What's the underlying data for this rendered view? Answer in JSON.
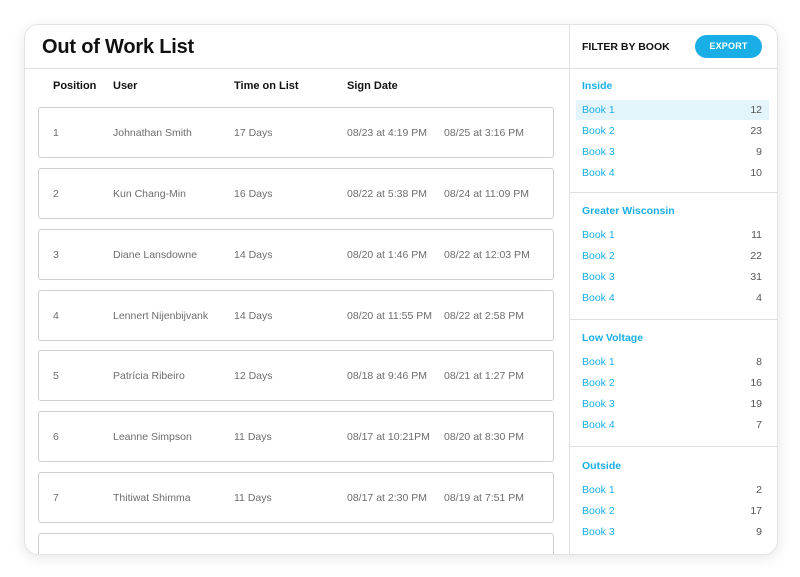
{
  "title": "Out of Work List",
  "columns": {
    "position": "Position",
    "user": "User",
    "time": "Time on List",
    "sign": "Sign Date"
  },
  "rows": [
    {
      "position": "1",
      "user": "Johnathan Smith",
      "time": "17 Days",
      "sign": "08/23 at 4:19 PM",
      "date2": "08/25 at 3:16 PM"
    },
    {
      "position": "2",
      "user": "Kun Chang-Min",
      "time": "16 Days",
      "sign": "08/22 at 5:38 PM",
      "date2": "08/24 at 11:09 PM"
    },
    {
      "position": "3",
      "user": "Diane Lansdowne",
      "time": "14 Days",
      "sign": "08/20 at 1:46 PM",
      "date2": "08/22 at 12:03 PM"
    },
    {
      "position": "4",
      "user": "Lennert Nijenbijvank",
      "time": "14 Days",
      "sign": "08/20 at 11:55 PM",
      "date2": "08/22 at 2:58 PM"
    },
    {
      "position": "5",
      "user": "Patrícia Ribeiro",
      "time": "12 Days",
      "sign": "08/18 at 9:46 PM",
      "date2": "08/21 at 1:27 PM"
    },
    {
      "position": "6",
      "user": "Leanne Simpson",
      "time": "11 Days",
      "sign": "08/17 at 10:21PM",
      "date2": "08/20 at 8:30 PM"
    },
    {
      "position": "7",
      "user": "Thitiwat Shimma",
      "time": "11 Days",
      "sign": "08/17 at 2:30 PM",
      "date2": "08/19 at 7:51 PM"
    }
  ],
  "sidebar": {
    "filter_label": "FILTER BY BOOK",
    "export_label": "EXPORT",
    "selected": "Inside / Book 1",
    "groups": [
      {
        "name": "Inside",
        "books": [
          {
            "name": "Book 1",
            "count": "12"
          },
          {
            "name": "Book 2",
            "count": "23"
          },
          {
            "name": "Book 3",
            "count": "9"
          },
          {
            "name": "Book 4",
            "count": "10"
          }
        ]
      },
      {
        "name": "Greater Wisconsin",
        "books": [
          {
            "name": "Book 1",
            "count": "11"
          },
          {
            "name": "Book 2",
            "count": "22"
          },
          {
            "name": "Book 3",
            "count": "31"
          },
          {
            "name": "Book 4",
            "count": "4"
          }
        ]
      },
      {
        "name": "Low Voltage",
        "books": [
          {
            "name": "Book 1",
            "count": "8"
          },
          {
            "name": "Book 2",
            "count": "16"
          },
          {
            "name": "Book 3",
            "count": "19"
          },
          {
            "name": "Book 4",
            "count": "7"
          }
        ]
      },
      {
        "name": "Outside",
        "books": [
          {
            "name": "Book 1",
            "count": "2"
          },
          {
            "name": "Book 2",
            "count": "17"
          },
          {
            "name": "Book 3",
            "count": "9"
          }
        ]
      }
    ]
  },
  "colors": {
    "accent": "#1aaee6",
    "selected_bg": "#e3f4fb"
  }
}
